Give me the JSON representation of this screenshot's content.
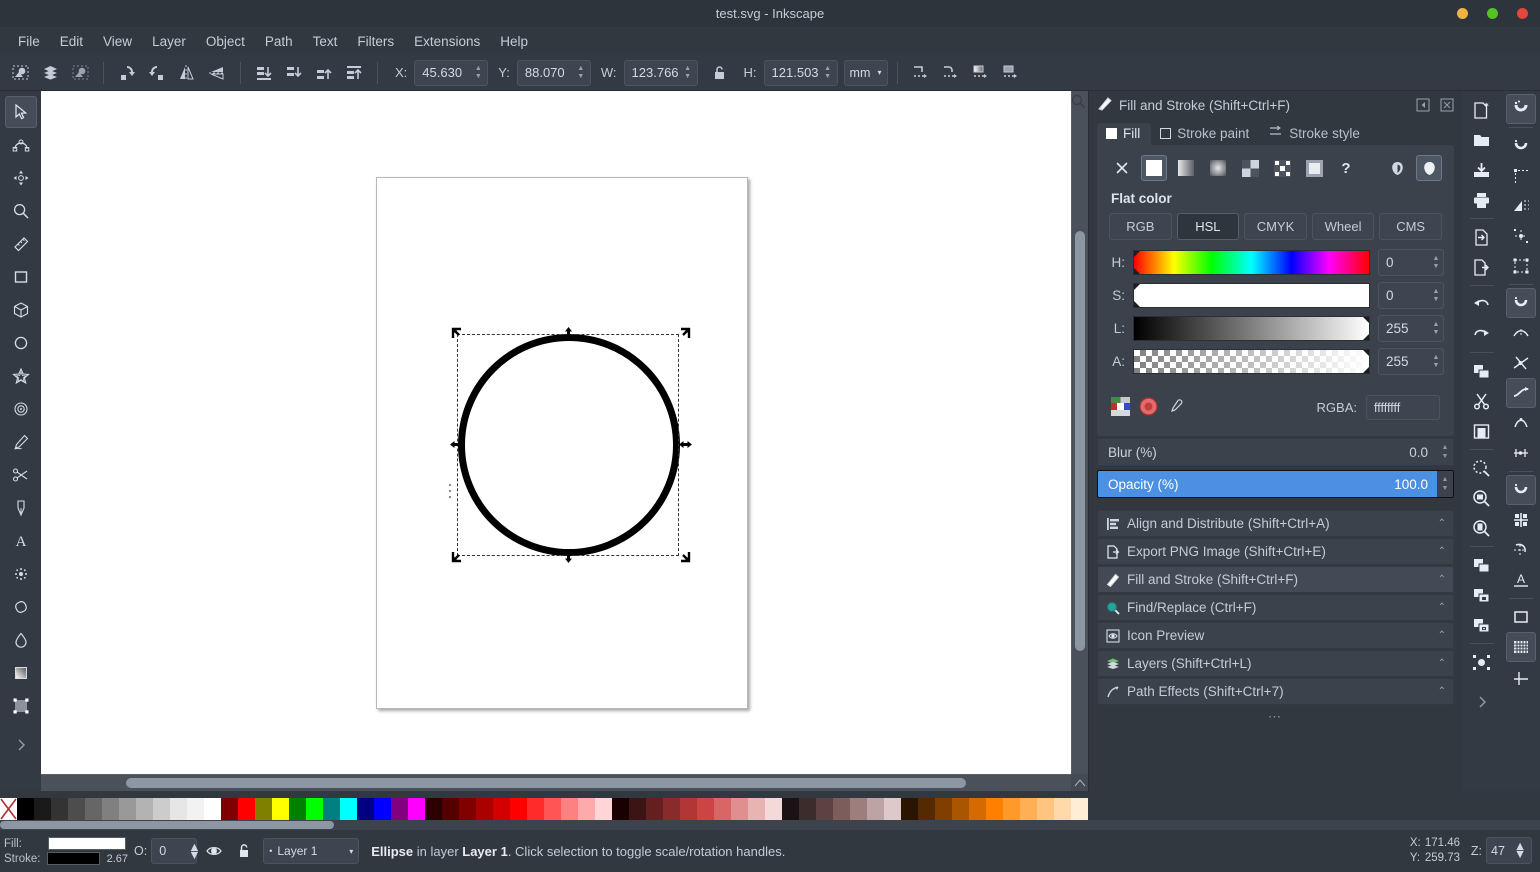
{
  "window": {
    "title": "test.svg - Inkscape",
    "buttons": [
      "minimize",
      "maximize",
      "close"
    ]
  },
  "menubar": {
    "items": [
      "File",
      "Edit",
      "View",
      "Layer",
      "Object",
      "Path",
      "Text",
      "Filters",
      "Extensions",
      "Help"
    ]
  },
  "tooloptions": {
    "icons_left": [
      "select-all-icon",
      "select-all-layers-icon",
      "deselect-icon"
    ],
    "rotate_icons": [
      "rotate-ccw-icon",
      "rotate-cw-icon",
      "flip-horizontal-icon",
      "flip-vertical-icon"
    ],
    "raise_icons": [
      "lower-to-bottom-icon",
      "lower-icon",
      "raise-icon",
      "raise-to-top-icon"
    ],
    "x": {
      "label": "X:",
      "value": "45.630"
    },
    "y": {
      "label": "Y:",
      "value": "88.070"
    },
    "w": {
      "label": "W:",
      "value": "123.766"
    },
    "h": {
      "label": "H:",
      "value": "121.503"
    },
    "lock": "unlocked-ratio-icon",
    "unit": "mm",
    "affect_icons": [
      "affect-stroke-icon",
      "affect-corners-icon",
      "affect-gradients-icon",
      "affect-patterns-icon"
    ]
  },
  "toolbox": {
    "tools": [
      {
        "name": "selector-tool",
        "icon": "arrow-cursor-icon",
        "active": true
      },
      {
        "name": "node-tool",
        "icon": "node-editor-icon",
        "active": false
      },
      {
        "name": "transform-tool",
        "icon": "move-arrows-icon",
        "active": false
      },
      {
        "name": "zoom-tool",
        "icon": "magnifier-icon",
        "active": false
      },
      {
        "name": "measure-tool",
        "icon": "ruler-icon",
        "active": false
      },
      {
        "name": "rectangle-tool",
        "icon": "square-icon",
        "active": false
      },
      {
        "name": "box3d-tool",
        "icon": "cube-icon",
        "active": false
      },
      {
        "name": "ellipse-tool",
        "icon": "circle-icon",
        "active": false
      },
      {
        "name": "star-tool",
        "icon": "star-icon",
        "active": false
      },
      {
        "name": "spiral-tool",
        "icon": "spiral-icon",
        "active": false
      },
      {
        "name": "pencil-tool",
        "icon": "pencil-icon",
        "active": false
      },
      {
        "name": "scissors-tool",
        "icon": "scissors-icon",
        "active": false
      },
      {
        "name": "pen-tool",
        "icon": "calligraphy-pen-icon",
        "active": false
      },
      {
        "name": "text-tool",
        "icon": "letter-a-icon",
        "active": false
      },
      {
        "name": "spray-tool",
        "icon": "spray-icon",
        "active": false
      },
      {
        "name": "eraser-tool",
        "icon": "eraser-icon",
        "active": false
      },
      {
        "name": "paint-bucket-tool",
        "icon": "droplet-icon",
        "active": false
      },
      {
        "name": "gradient-tool",
        "icon": "gradient-icon",
        "active": false
      },
      {
        "name": "mesh-gradient-tool",
        "icon": "mesh-gradient-icon",
        "active": false
      },
      {
        "name": "more-tools",
        "icon": "chevron-right-icon",
        "active": false
      }
    ]
  },
  "canvas": {
    "object": "ellipse",
    "page_background": "#ffffff",
    "stroke_color": "#000000",
    "fill_color": "#ffffff"
  },
  "panel": {
    "header": {
      "title": "Fill and Stroke (Shift+Ctrl+F)",
      "icon": "fill-stroke-icon"
    },
    "tabs": [
      {
        "label": "Fill",
        "icon": "filled-square-icon",
        "active": true
      },
      {
        "label": "Stroke paint",
        "icon": "outline-square-icon",
        "active": false
      },
      {
        "label": "Stroke style",
        "icon": "stroke-style-icon",
        "active": false
      }
    ],
    "paint_buttons": [
      {
        "name": "no-paint-button",
        "icon": "x-icon",
        "selected": false
      },
      {
        "name": "flat-color-button",
        "icon": "flat-color-icon",
        "selected": true
      },
      {
        "name": "linear-gradient-button",
        "icon": "linear-gradient-icon",
        "selected": false
      },
      {
        "name": "radial-gradient-button",
        "icon": "radial-gradient-icon",
        "selected": false
      },
      {
        "name": "pattern-button",
        "icon": "pattern-icon",
        "selected": false
      },
      {
        "name": "swatch-button",
        "icon": "swatch-icon",
        "selected": false
      },
      {
        "name": "mesh-gradient-button",
        "icon": "mesh-icon",
        "selected": false
      },
      {
        "name": "unknown-paint-button",
        "icon": "question-mark-icon",
        "selected": false
      }
    ],
    "fillrule_buttons": [
      {
        "name": "even-odd-fill-button",
        "icon": "even-odd-icon",
        "selected": false
      },
      {
        "name": "nonzero-fill-button",
        "icon": "nonzero-icon",
        "selected": true
      }
    ],
    "flat_color_label": "Flat color",
    "color_modes": [
      {
        "label": "RGB",
        "active": false
      },
      {
        "label": "HSL",
        "active": true
      },
      {
        "label": "CMYK",
        "active": false
      },
      {
        "label": "Wheel",
        "active": false
      },
      {
        "label": "CMS",
        "active": false
      }
    ],
    "sliders": [
      {
        "label": "H:",
        "value": "0",
        "type": "hue"
      },
      {
        "label": "S:",
        "value": "0",
        "type": "saturation"
      },
      {
        "label": "L:",
        "value": "255",
        "type": "lightness"
      },
      {
        "label": "A:",
        "value": "255",
        "type": "alpha"
      }
    ],
    "rgba": {
      "label": "RGBA:",
      "value": "ffffffff"
    },
    "color_tools": [
      "color-picker-wheel-icon",
      "color-managed-icon",
      "eyedropper-icon"
    ],
    "blur": {
      "label": "Blur (%)",
      "value": "0.0"
    },
    "opacity": {
      "label": "Opacity (%)",
      "value": "100.0",
      "selected": true,
      "highlight_color": "#4b90e2"
    }
  },
  "dialogs": [
    {
      "label": "Align and Distribute (Shift+Ctrl+A)",
      "icon": "align-icon",
      "active": false
    },
    {
      "label": "Export PNG Image (Shift+Ctrl+E)",
      "icon": "export-icon",
      "active": false
    },
    {
      "label": "Fill and Stroke (Shift+Ctrl+F)",
      "icon": "fill-stroke-icon",
      "active": true
    },
    {
      "label": "Find/Replace (Ctrl+F)",
      "icon": "search-icon",
      "active": false
    },
    {
      "label": "Icon Preview",
      "icon": "eye-preview-icon",
      "active": false
    },
    {
      "label": "Layers (Shift+Ctrl+L)",
      "icon": "layers-icon",
      "active": false
    },
    {
      "label": "Path Effects  (Shift+Ctrl+7)",
      "icon": "path-effects-icon",
      "active": false
    }
  ],
  "dialog_overflow": "⋯",
  "commandbar": {
    "buttons": [
      "new-document-icon",
      "open-document-icon",
      "save-document-icon",
      "print-icon",
      "import-icon",
      "export-icon",
      "undo-icon",
      "redo-icon",
      "copy-icon",
      "cut-icon",
      "paste-icon",
      "zoom-selection-icon",
      "zoom-drawing-icon",
      "zoom-page-icon",
      "duplicate-icon",
      "clone-icon",
      "unlink-clone-icon",
      "group-icon",
      "more-commands-icon"
    ]
  },
  "snapbar": {
    "buttons": [
      {
        "icon": "enable-snapping-icon",
        "on": true
      },
      {
        "icon": "snap-bounding-box-icon",
        "on": false
      },
      {
        "icon": "snap-bbox-corner-icon",
        "on": false
      },
      {
        "icon": "snap-bbox-edge-icon",
        "on": false
      },
      {
        "icon": "snap-bbox-midpoint-icon",
        "on": false
      },
      {
        "icon": "snap-bbox-center-icon",
        "on": false
      },
      {
        "icon": "snap-nodes-icon",
        "on": true
      },
      {
        "icon": "snap-paths-icon",
        "on": false
      },
      {
        "icon": "snap-path-intersection-icon",
        "on": false
      },
      {
        "icon": "snap-cusp-nodes-icon",
        "on": true
      },
      {
        "icon": "snap-smooth-nodes-icon",
        "on": false
      },
      {
        "icon": "snap-midpoints-icon",
        "on": false
      },
      {
        "icon": "snap-others-icon",
        "on": true
      },
      {
        "icon": "snap-object-centers-icon",
        "on": false
      },
      {
        "icon": "snap-rotation-center-icon",
        "on": false
      },
      {
        "icon": "snap-text-baseline-icon",
        "on": false
      },
      {
        "icon": "snap-page-border-icon",
        "on": false
      },
      {
        "icon": "snap-grid-icon",
        "on": true
      },
      {
        "icon": "snap-guides-icon",
        "on": false
      }
    ]
  },
  "palette": {
    "none_swatch": "no-color-icon",
    "colors": [
      "#000000",
      "#1a1a1a",
      "#333333",
      "#4d4d4d",
      "#666666",
      "#808080",
      "#999999",
      "#b3b3b3",
      "#cccccc",
      "#e6e6e6",
      "#f2f2f2",
      "#ffffff",
      "#800000",
      "#ff0000",
      "#808000",
      "#ffff00",
      "#008000",
      "#00ff00",
      "#008080",
      "#00ffff",
      "#000080",
      "#0000ff",
      "#800080",
      "#ff00ff",
      "#2b0000",
      "#550000",
      "#800000",
      "#aa0000",
      "#d40000",
      "#ff0000",
      "#ff2a2a",
      "#ff5555",
      "#ff8080",
      "#ffaaaa",
      "#ffd5d5",
      "#1a0000",
      "#3d1414",
      "#661f1f",
      "#8a2b2b",
      "#b33636",
      "#cc4444",
      "#d96666",
      "#e08e8e",
      "#eab3b3",
      "#f5d9d9",
      "#1a1214",
      "#3d2c2c",
      "#5c4242",
      "#7d5c5c",
      "#9e7d7d",
      "#bda3a3",
      "#ddc9c9",
      "#2b1400",
      "#552a00",
      "#803f00",
      "#aa5500",
      "#d46a00",
      "#ff8000",
      "#ff9a2a",
      "#ffb055",
      "#ffc580",
      "#ffd9aa",
      "#ffeed5"
    ]
  },
  "statusbar": {
    "fill": {
      "label": "Fill:",
      "color": "#ffffff"
    },
    "stroke": {
      "label": "Stroke:",
      "color": "#000000",
      "width": "2.67"
    },
    "opacity": {
      "label": "O:",
      "value": "0"
    },
    "visibility_icon": "eye-icon",
    "lock_icon": "unlock-icon",
    "layer": {
      "name": "Layer 1",
      "indicator": "•"
    },
    "message": {
      "object": "Ellipse",
      "mid": " in layer ",
      "layer": "Layer 1",
      "tail": ". Click selection to toggle scale/rotation handles."
    },
    "cursor": {
      "x_label": "X:",
      "x": "171.46",
      "y_label": "Y:",
      "y": "259.73"
    },
    "zoom": {
      "label": "Z:",
      "value": "47"
    }
  }
}
